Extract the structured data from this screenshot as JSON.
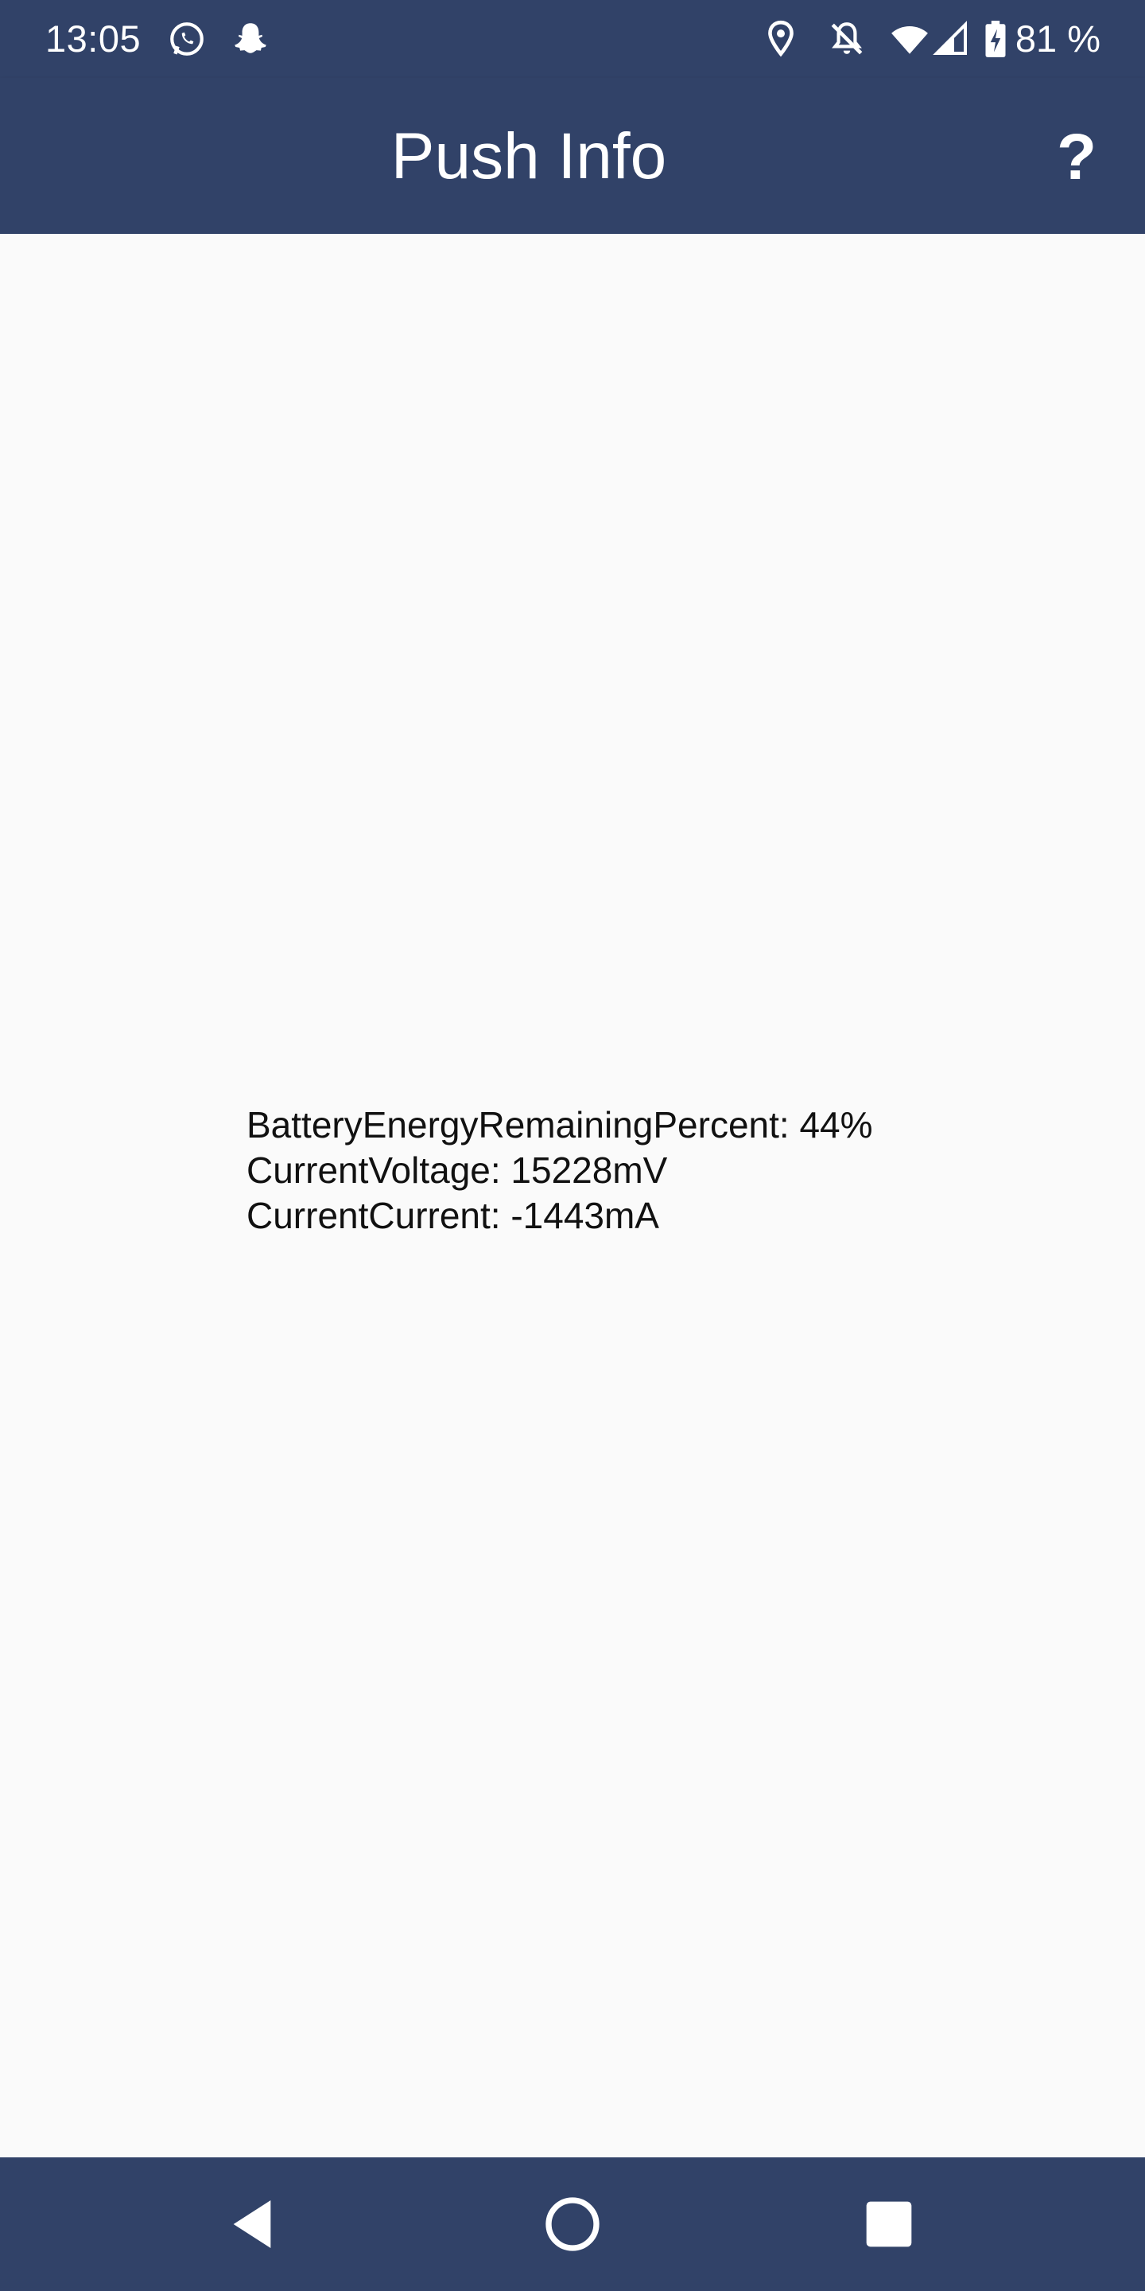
{
  "status_bar": {
    "time": "13:05",
    "battery_percent": "81 %",
    "icons": [
      "whatsapp-icon",
      "snapchat-icon",
      "location-icon",
      "notifications-off-icon",
      "wifi-icon",
      "cellular-signal-icon",
      "battery-charging-icon"
    ]
  },
  "app_bar": {
    "title": "Push Info",
    "help_label": "?"
  },
  "info": {
    "battery_energy": "BatteryEnergyRemainingPercent: 44%",
    "voltage": "CurrentVoltage: 15228mV",
    "current": "CurrentCurrent: -1443mA"
  },
  "nav_bar": {
    "buttons": [
      "back-icon",
      "home-icon",
      "recents-icon"
    ]
  },
  "colors": {
    "primary": "#314268",
    "background": "#fafafa",
    "text": "#111111"
  }
}
